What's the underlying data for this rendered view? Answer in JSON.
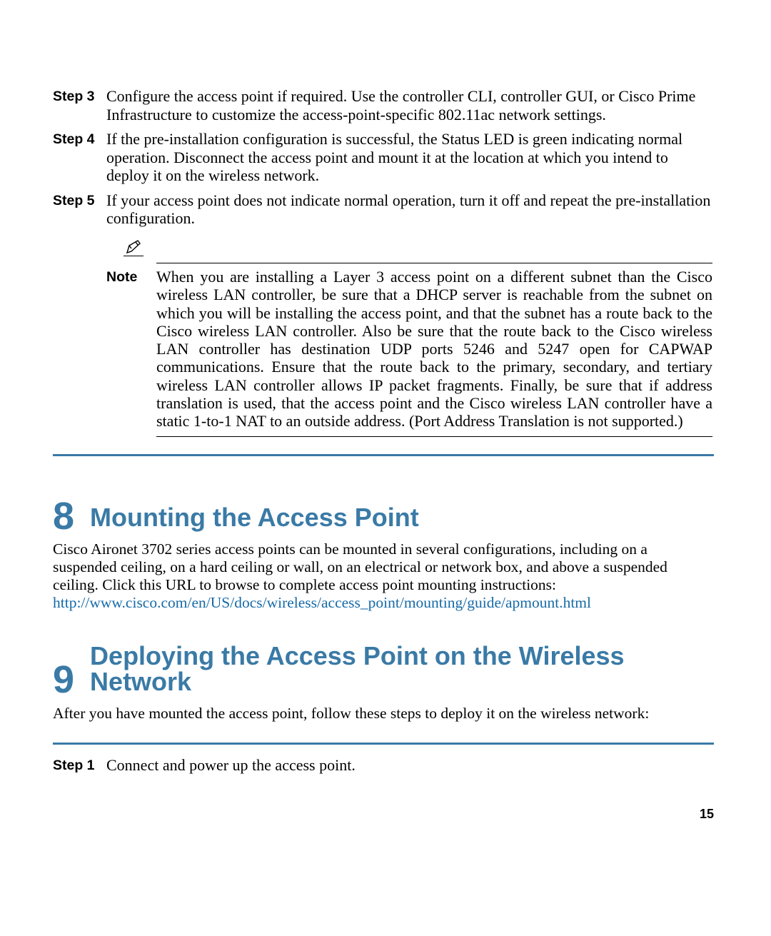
{
  "steps_top": [
    {
      "label": "Step 3",
      "text": "Configure the access point if required. Use the controller CLI, controller GUI, or Cisco Prime Infrastructure to customize the access-point-specific 802.11ac network settings."
    },
    {
      "label": "Step 4",
      "text": "If the pre-installation configuration is successful, the Status LED is green indicating normal operation. Disconnect the access point and mount it at the location at which you intend to deploy it on the wireless network."
    },
    {
      "label": "Step 5",
      "text": "If your access point does not indicate normal operation, turn it off and repeat the pre-installation configuration."
    }
  ],
  "note": {
    "label": "Note",
    "text": "When you are installing a Layer 3 access point on a different subnet than the Cisco wireless LAN controller, be sure that a DHCP server is reachable from the subnet on which you will be installing the access point, and that the subnet has a route back to the Cisco wireless LAN controller. Also be sure that the route back to the Cisco wireless LAN controller has destination UDP ports 5246 and 5247 open for CAPWAP communications. Ensure that the route back to the primary, secondary, and tertiary wireless LAN controller allows IP packet fragments. Finally, be sure that if address translation is used, that the access point and the Cisco wireless LAN controller have a static 1-to-1 NAT to an outside address. (Port Address Translation is not supported.)"
  },
  "section8": {
    "number": "8",
    "title": "Mounting the Access Point",
    "body": "Cisco Aironet 3702 series access points can be mounted in several configurations, including on a suspended ceiling, on a hard ceiling or wall, on an electrical or network box, and above a suspended ceiling. Click this URL to browse to complete access point mounting instructions:",
    "link_text": "http://www.cisco.com/en/US/docs/wireless/access_point/mounting/guide/apmount.html",
    "link_href": "http://www.cisco.com/en/US/docs/wireless/access_point/mounting/guide/apmount.html"
  },
  "section9": {
    "number": "9",
    "title": "Deploying the Access Point on the Wireless Network",
    "body": "After you have mounted the access point, follow these steps to deploy it on the wireless network:"
  },
  "steps_bottom": [
    {
      "label": "Step 1",
      "text": "Connect and power up the access point."
    }
  ],
  "page_number": "15"
}
